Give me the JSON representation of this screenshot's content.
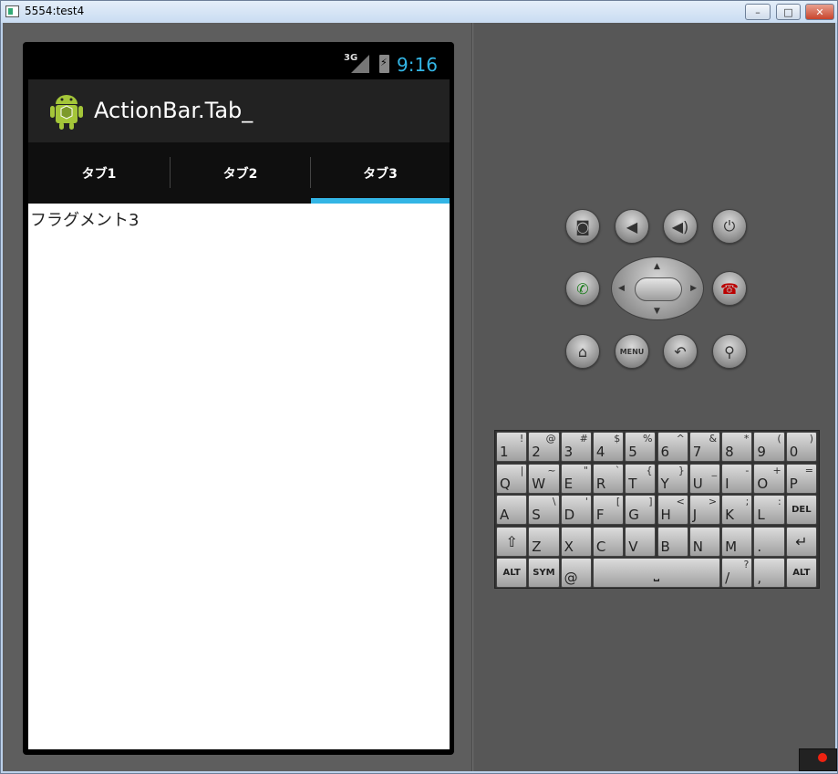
{
  "window": {
    "title": "5554:test4",
    "min_label": "–",
    "max_label": "□",
    "close_label": "✕"
  },
  "status_bar": {
    "network": "3G",
    "time": "9:16"
  },
  "action_bar": {
    "title": "ActionBar.Tab_"
  },
  "tabs": [
    {
      "label": "タブ1",
      "selected": false
    },
    {
      "label": "タブ2",
      "selected": false
    },
    {
      "label": "タブ3",
      "selected": true
    }
  ],
  "content": {
    "text": "フラグメント3"
  },
  "accent_color": "#33b5e5",
  "controls": {
    "menu_label": "MENU"
  },
  "keyboard": {
    "row1": [
      {
        "main": "1",
        "alt": "!"
      },
      {
        "main": "2",
        "alt": "@"
      },
      {
        "main": "3",
        "alt": "#"
      },
      {
        "main": "4",
        "alt": "$"
      },
      {
        "main": "5",
        "alt": "%"
      },
      {
        "main": "6",
        "alt": "^"
      },
      {
        "main": "7",
        "alt": "&"
      },
      {
        "main": "8",
        "alt": "*"
      },
      {
        "main": "9",
        "alt": "("
      },
      {
        "main": "0",
        "alt": ")"
      }
    ],
    "row2": [
      {
        "main": "Q",
        "alt": "|"
      },
      {
        "main": "W",
        "alt": "~"
      },
      {
        "main": "E",
        "alt": "\""
      },
      {
        "main": "R",
        "alt": "`"
      },
      {
        "main": "T",
        "alt": "{"
      },
      {
        "main": "Y",
        "alt": "}"
      },
      {
        "main": "U",
        "alt": "_"
      },
      {
        "main": "I",
        "alt": "-"
      },
      {
        "main": "O",
        "alt": "+"
      },
      {
        "main": "P",
        "alt": "="
      }
    ],
    "row3": [
      {
        "main": "A",
        "alt": ""
      },
      {
        "main": "S",
        "alt": "\\"
      },
      {
        "main": "D",
        "alt": "'"
      },
      {
        "main": "F",
        "alt": "["
      },
      {
        "main": "G",
        "alt": "]"
      },
      {
        "main": "H",
        "alt": "<"
      },
      {
        "main": "J",
        "alt": ">"
      },
      {
        "main": "K",
        "alt": ";"
      },
      {
        "main": "L",
        "alt": ":"
      }
    ],
    "del_label": "DEL",
    "row4": [
      {
        "main": "Z",
        "alt": ""
      },
      {
        "main": "X",
        "alt": ""
      },
      {
        "main": "C",
        "alt": ""
      },
      {
        "main": "V",
        "alt": ""
      },
      {
        "main": "B",
        "alt": ""
      },
      {
        "main": "N",
        "alt": ""
      },
      {
        "main": "M",
        "alt": ""
      },
      {
        "main": ".",
        "alt": ""
      }
    ],
    "alt_label": "ALT",
    "sym_label": "SYM",
    "at_label": "@",
    "slash_label": "/",
    "slash_alt": "?",
    "comma_label": ","
  }
}
